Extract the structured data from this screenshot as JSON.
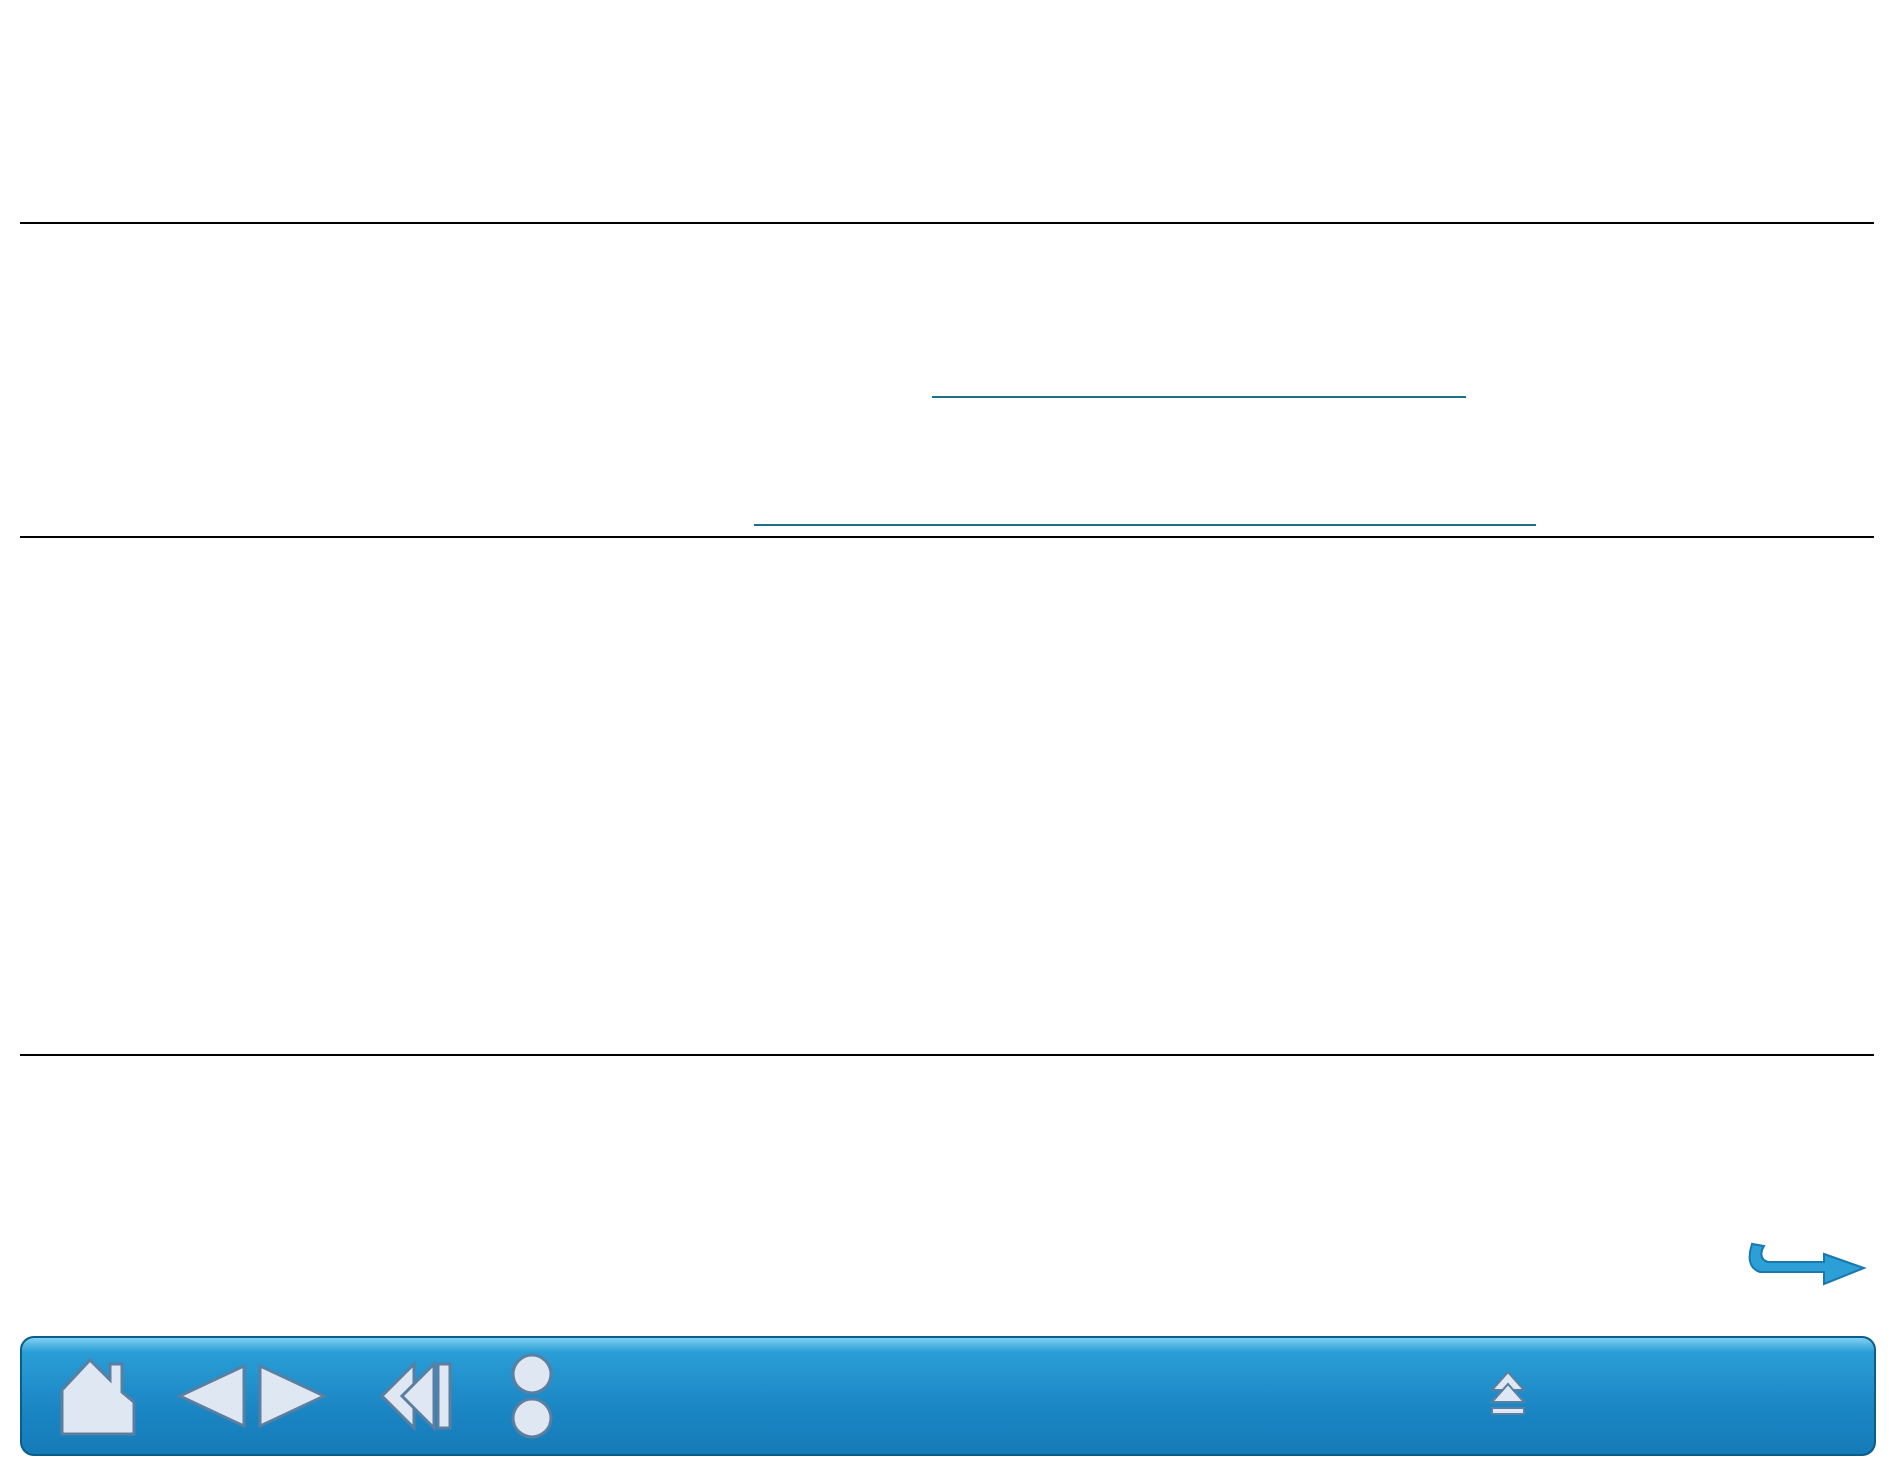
{
  "body": [
    {
      "kind": "rule"
    },
    {
      "kind": "link_underline"
    },
    {
      "kind": "link_underline"
    },
    {
      "kind": "rule"
    },
    {
      "kind": "rule"
    }
  ],
  "next_page_button": {
    "kind": "curved_arrow"
  },
  "nav_bar": {
    "buttons": [
      {
        "kind": "home"
      },
      {
        "kind": "previous"
      },
      {
        "kind": "next"
      },
      {
        "kind": "back"
      },
      {
        "kind": "zoom"
      },
      {
        "kind": "top"
      }
    ]
  }
}
